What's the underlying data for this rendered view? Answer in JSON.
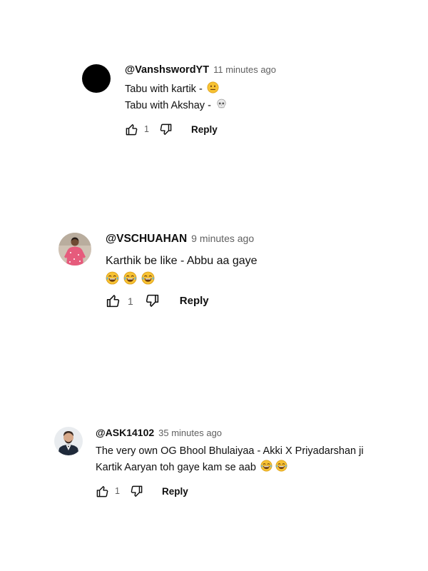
{
  "comments": [
    {
      "handle": "@VanshswordYT",
      "time": "11 minutes ago",
      "lines": [
        "Tabu with kartik -",
        "Tabu with Akshay -"
      ],
      "line_emojis": [
        "neutral-face",
        "skull"
      ],
      "likes": "1",
      "reply_label": "Reply",
      "avatar": "black-circle"
    },
    {
      "handle": "@VSCHUAHAN",
      "time": "9 minutes ago",
      "lines": [
        "Karthik be like - Abbu aa gaye"
      ],
      "emoji_row": [
        "tears-of-joy",
        "tears-of-joy",
        "tears-of-joy"
      ],
      "likes": "1",
      "reply_label": "Reply",
      "avatar": "person-pink-shirt"
    },
    {
      "handle": "@ASK14102",
      "time": "35 minutes ago",
      "lines": [
        "The very own OG Bhool Bhulaiyaa - Akki X Priyadarshan ji",
        "Kartik Aaryan toh gaye kam se aab"
      ],
      "line_emojis": [
        "tears-of-joy",
        "tears-of-joy"
      ],
      "likes": "1",
      "reply_label": "Reply",
      "avatar": "person-suit"
    }
  ],
  "colors": {
    "text": "#0f0f0f",
    "secondary": "#606060",
    "background": "#ffffff",
    "emoji_yellow": "#f7c233"
  }
}
